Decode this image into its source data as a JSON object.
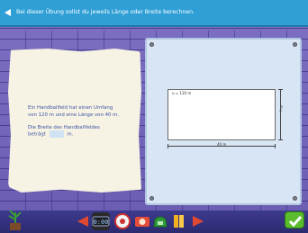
{
  "header": {
    "instruction": "Bei dieser Übung sollst du jeweils Länge oder Breite berechnen."
  },
  "task": {
    "line1": "Ein Handballfeld hat einen Umfang",
    "line2": "von 120 m und eine Länge von 40 m.",
    "question_line1": "Die Breite des Handballfeldes",
    "question_prefix": "beträgt",
    "question_unit": "m.",
    "answer_value": ""
  },
  "diagram": {
    "perimeter_label": "u = 120 m",
    "width_label": "? m",
    "length_label": "40 m"
  },
  "colors": {
    "header": "#2f9fd6",
    "text": "#3e56a6",
    "ok": "#5bbd2d"
  },
  "toolbar": {
    "icons": [
      "arrow-left-icon",
      "hat-icon",
      "clock-icon",
      "brain-icon",
      "camera-icon",
      "pencil-icon",
      "arrow-right-icon",
      "check-icon"
    ]
  }
}
